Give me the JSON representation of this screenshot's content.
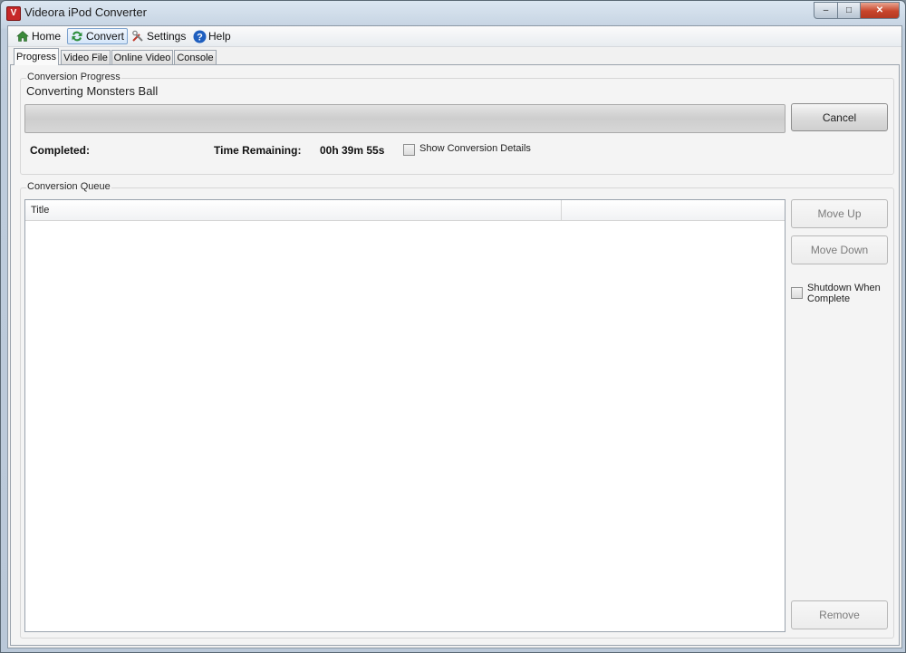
{
  "window": {
    "title": "Videora iPod Converter",
    "app_icon_glyph": "V",
    "buttons": {
      "minimize": "–",
      "maximize": "□",
      "close": "✕"
    }
  },
  "toolbar": {
    "items": [
      {
        "label": "Home",
        "icon": "home-icon"
      },
      {
        "label": "Convert",
        "icon": "convert-icon",
        "active": true
      },
      {
        "label": "Settings",
        "icon": "settings-icon"
      },
      {
        "label": "Help",
        "icon": "help-icon"
      }
    ]
  },
  "tabs": [
    {
      "label": "Progress",
      "selected": true
    },
    {
      "label": "Video File"
    },
    {
      "label": "Online Video"
    },
    {
      "label": "Console"
    }
  ],
  "conversion_progress": {
    "group_title": "Conversion Progress",
    "converting_text": "Converting Monsters Ball",
    "progress_fraction": 0,
    "cancel_label": "Cancel",
    "completed_label": "Completed:",
    "time_remaining_label": "Time Remaining:",
    "time_remaining_value": "00h 39m 55s",
    "show_details_label": "Show Conversion Details",
    "show_details_checked": false
  },
  "conversion_queue": {
    "group_title": "Conversion Queue",
    "columns": [
      "Title",
      ""
    ],
    "rows": [],
    "move_up_label": "Move Up",
    "move_down_label": "Move Down",
    "shutdown_label_line1": "Shutdown When",
    "shutdown_label_line2": "Complete",
    "shutdown_checked": false,
    "remove_label": "Remove"
  },
  "colors": {
    "titlebar": "#c5d3e2",
    "close_button": "#c8442a",
    "help_icon": "#1f5fbf",
    "home_icon": "#3a8a3a",
    "convert_icon": "#2f8f3f"
  }
}
